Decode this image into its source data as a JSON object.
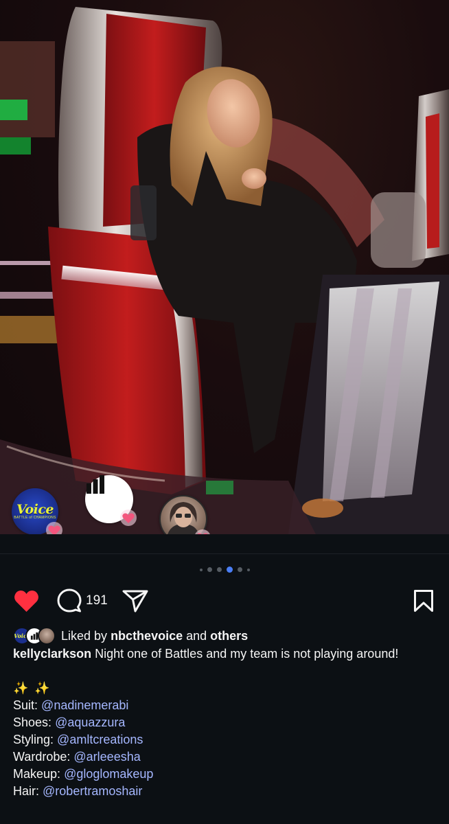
{
  "photo": {
    "reactors": [
      {
        "kind": "account-avatar",
        "icon": "the-voice-logo",
        "logo_word": "Voice",
        "logo_sub": "BATTLE of CHAMPIONS"
      },
      {
        "kind": "account-avatar",
        "icon": "bar-chart-icon"
      },
      {
        "kind": "account-avatar",
        "icon": "person-avatar"
      }
    ],
    "badge_icon": "heart-badge-icon"
  },
  "carousel": {
    "count": 5,
    "active_index": 3
  },
  "actions": {
    "liked": true,
    "comment_count": "191",
    "like_color": "#ff3040"
  },
  "likes": {
    "prefix": "Liked by",
    "user": "nbcthevoice",
    "joiner": "and",
    "others": "others"
  },
  "caption": {
    "username": "kellyclarkson",
    "text": "Night one of Battles and my team is not playing around!",
    "sparkles": "✨ ✨",
    "credits": [
      {
        "label": "Suit:",
        "handle": "@nadinemerabi"
      },
      {
        "label": "Shoes:",
        "handle": "@aquazzura"
      },
      {
        "label": "Styling:",
        "handle": "@amltcreations"
      },
      {
        "label": "Wardrobe:",
        "handle": "@arleeesha"
      },
      {
        "label": "Makeup:",
        "handle": "@gloglomakeup"
      },
      {
        "label": "Hair:",
        "handle": "@robertramoshair"
      }
    ]
  },
  "colors": {
    "background": "#0c1014",
    "link": "#a5b7ff",
    "active_dot": "#4a7ef5"
  }
}
